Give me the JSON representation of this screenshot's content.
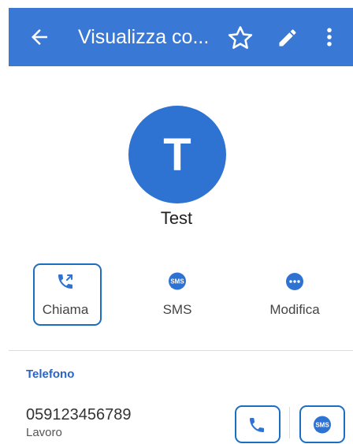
{
  "appbar": {
    "title": "Visualizza co...",
    "color": "#3a78d6",
    "icons": [
      "back-arrow-icon",
      "star-outline-icon",
      "pencil-icon",
      "more-vertical-icon"
    ]
  },
  "contact": {
    "initial": "T",
    "name": "Test"
  },
  "actions": {
    "call_label": "Chiama",
    "sms_label": "SMS",
    "edit_label": "Modifica"
  },
  "phone_section": {
    "title": "Telefono",
    "number": "059123456789",
    "type": "Lavoro"
  },
  "colors": {
    "accent": "#2f73d2",
    "highlight": "#1b6ec2"
  }
}
